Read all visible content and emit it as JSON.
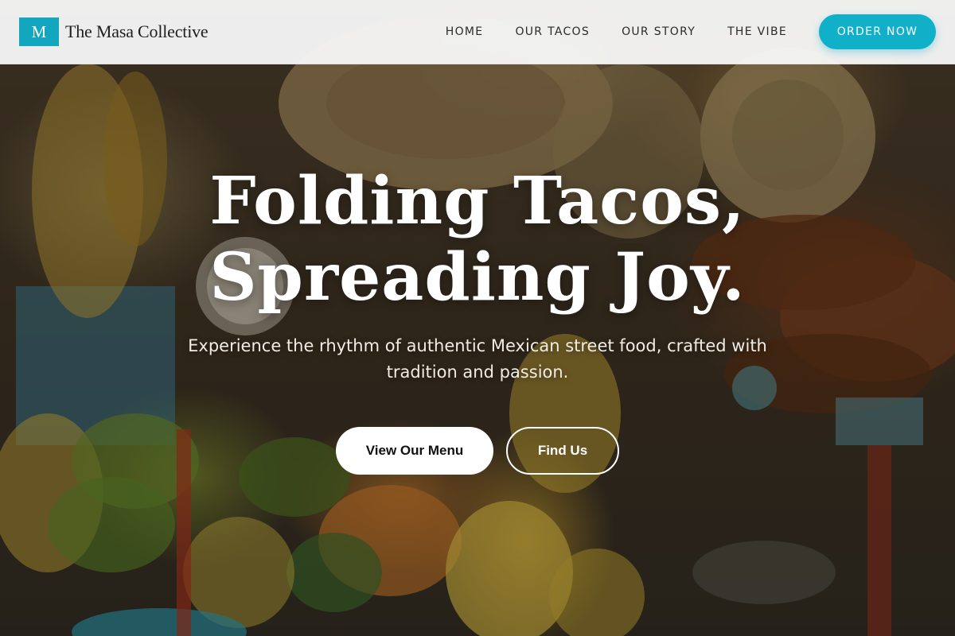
{
  "header": {
    "logo_letter": "M",
    "brand_name": "The Masa Collective",
    "nav": [
      {
        "label": "HOME"
      },
      {
        "label": "OUR TACOS"
      },
      {
        "label": "OUR STORY"
      },
      {
        "label": "THE VIBE"
      }
    ],
    "order_label": "ORDER NOW"
  },
  "hero": {
    "title_line_1": "Folding Tacos,",
    "title_line_2": "Spreading Joy.",
    "subtitle": "Experience the rhythm of authentic Mexican street food, crafted with tradition and passion.",
    "primary_button": "View Our Menu",
    "secondary_button": "Find Us",
    "background_scene": "market-stall-photo"
  },
  "colors": {
    "accent": "#0fb0c8",
    "logo_bg": "#12a7be",
    "navbar_bg": "#f6f6f6",
    "text_dark": "#1e1e1e",
    "hero_text": "#ffffff"
  }
}
